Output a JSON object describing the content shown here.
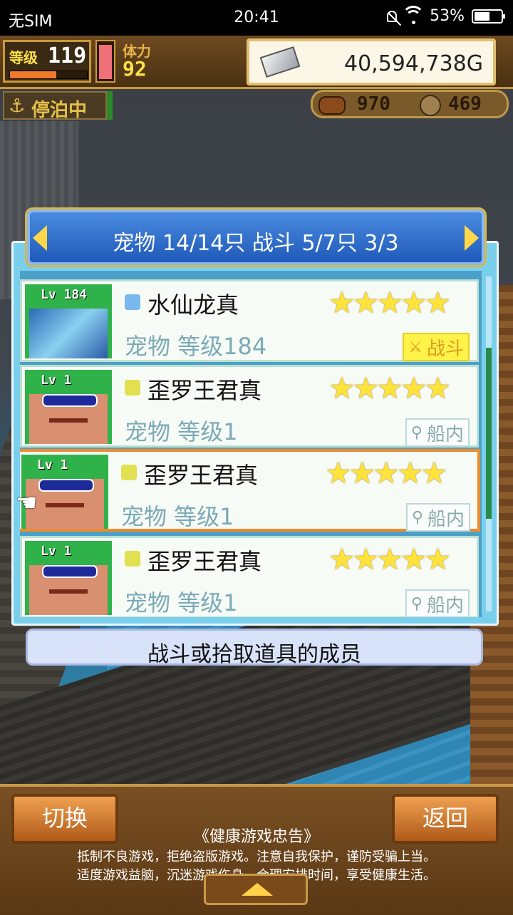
{
  "status_bar": {
    "carrier": "无SIM",
    "time": "20:41",
    "battery": "53%"
  },
  "hud": {
    "level_label": "等级",
    "level": "119",
    "stamina_label": "体力",
    "stamina": "92",
    "gold": "40,594,738G",
    "docked_label": "停泊中",
    "food": "970",
    "wood": "469"
  },
  "dialog": {
    "title": "宠物 14/14只 战斗 5/7只 3/3",
    "pets": [
      {
        "lv": "Lv 184",
        "name": "水仙龙真",
        "sub": "宠物 等级184",
        "stars": "★★★★★",
        "status": "战斗"
      },
      {
        "lv": "Lv   1",
        "name": "歪罗王君真",
        "sub": "宠物 等级1",
        "stars": "★★★★★",
        "status": "船内"
      },
      {
        "lv": "Lv   1",
        "name": "歪罗王君真",
        "sub": "宠物 等级1",
        "stars": "★★★★★",
        "status": "船内"
      },
      {
        "lv": "Lv   1",
        "name": "歪罗王君真",
        "sub": "宠物 等级1",
        "stars": "★★★★★",
        "status": "船内"
      }
    ],
    "info": "战斗或拾取道具的成员"
  },
  "bottom": {
    "switch_label": "切换",
    "back_label": "返回",
    "notice_title": "《健康游戏忠告》",
    "notice_line1": "抵制不良游戏，拒绝盗版游戏。注意自我保护，谨防受骗上当。",
    "notice_line2": "适度游戏益脑，沉迷游戏伤身。合理安排时间，享受健康生活。"
  },
  "colors": {
    "selected_border": "#f08a2a",
    "header_blue": "#1f5ab8",
    "star_yellow": "#ffe23a"
  }
}
